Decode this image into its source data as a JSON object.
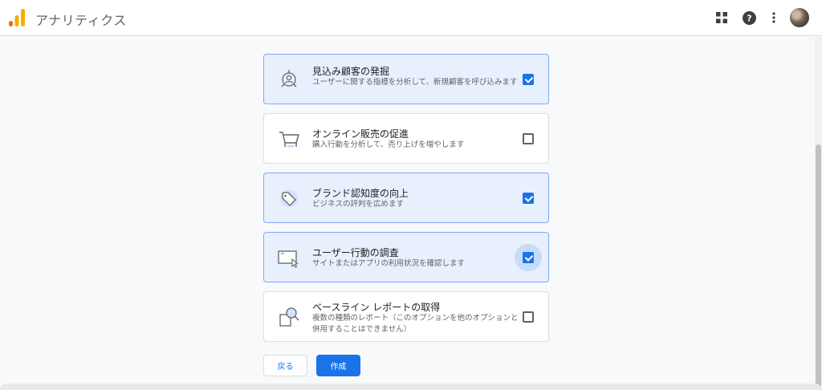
{
  "header": {
    "app_title": "アナリティクス",
    "icons": [
      "analytics-logo",
      "apps-grid-icon",
      "help-icon",
      "more-vert-icon",
      "account-avatar"
    ]
  },
  "options": [
    {
      "icon": "lead-target-icon",
      "title": "見込み顧客の発掘",
      "desc": "ユーザーに関する指標を分析して、新規顧客を呼び込みます",
      "checked": true
    },
    {
      "icon": "cart-icon",
      "title": "オンライン販売の促進",
      "desc": "購入行動を分析して、売り上げを増やします",
      "checked": false
    },
    {
      "icon": "tag-icon",
      "title": "ブランド認知度の向上",
      "desc": "ビジネスの評判を広めます",
      "checked": true
    },
    {
      "icon": "screen-cursor-icon",
      "title": "ユーザー行動の調査",
      "desc": "サイトまたはアプリの利用状況を確認します",
      "checked": true
    },
    {
      "icon": "baseline-report-icon",
      "title": "ベースライン レポートの取得",
      "desc": "複数の種類のレポート（このオプションを他のオプションと併用することはできません）",
      "checked": false
    }
  ],
  "buttons": {
    "back": "戻る",
    "create": "作成"
  },
  "colors": {
    "accent": "#1a73e8",
    "selected_bg": "#e8f0fe",
    "selected_border": "#7baaf7",
    "logo_orange": "#f9ab00",
    "logo_dark_orange": "#e37400"
  }
}
